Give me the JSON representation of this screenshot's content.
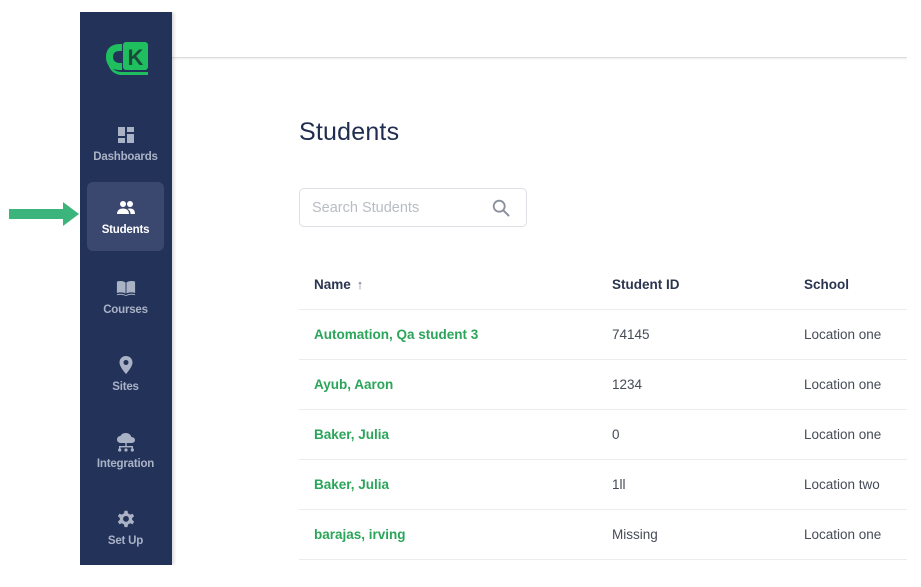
{
  "annotation": {
    "arrow_color": "#3cb57d",
    "arrow_points_to": "Students"
  },
  "sidebar": {
    "logo": "ck-logo",
    "logo_text": "K",
    "items": [
      {
        "label": "Dashboards",
        "icon": "dashboard-icon",
        "active": false
      },
      {
        "label": "Students",
        "icon": "people-icon",
        "active": true
      },
      {
        "label": "Courses",
        "icon": "book-icon",
        "active": false
      },
      {
        "label": "Sites",
        "icon": "map-pin-icon",
        "active": false
      },
      {
        "label": "Integration",
        "icon": "cloud-network-icon",
        "active": false
      },
      {
        "label": "Set Up",
        "icon": "gear-icon",
        "active": false
      }
    ]
  },
  "main": {
    "title": "Students",
    "search": {
      "placeholder": "Search Students",
      "value": "",
      "icon": "search-icon"
    },
    "table": {
      "columns": [
        {
          "label": "Name",
          "sort": "ascending",
          "sort_icon": "↑"
        },
        {
          "label": "Student ID"
        },
        {
          "label": "School"
        }
      ],
      "rows": [
        {
          "name": "Automation, Qa student 3",
          "student_id": "74145",
          "school": "Location one"
        },
        {
          "name": "Ayub, Aaron",
          "student_id": "1234",
          "school": "Location one"
        },
        {
          "name": "Baker, Julia",
          "student_id": "0",
          "school": "Location one"
        },
        {
          "name": "Baker, Julia",
          "student_id": "1ll",
          "school": "Location two"
        },
        {
          "name": "barajas, irving",
          "student_id": "Missing",
          "school": "Location one"
        }
      ]
    }
  },
  "colors": {
    "sidebar_bg": "#233259",
    "sidebar_active_bg": "#3a4870",
    "brand_green": "#2aa55a",
    "title_color": "#1f2d50"
  }
}
